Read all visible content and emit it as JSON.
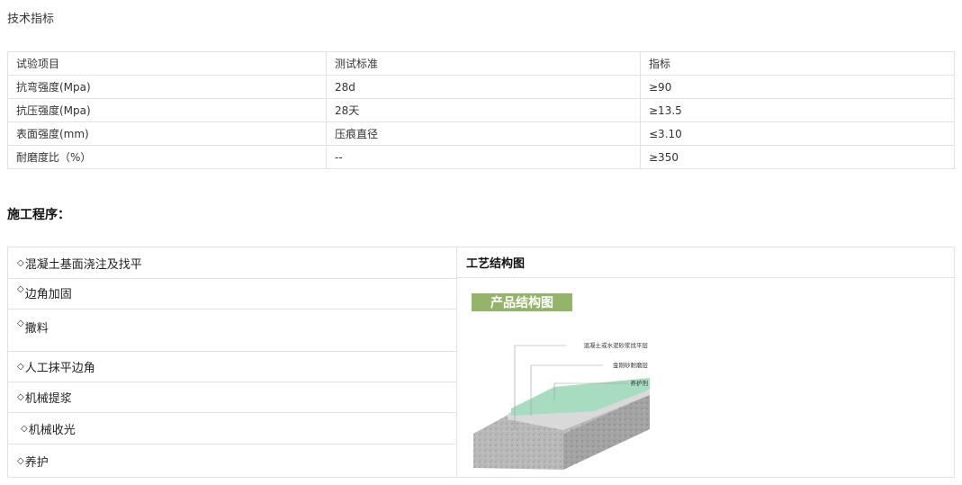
{
  "page_title": "技术指标",
  "spec_table": {
    "headers": [
      "试验项目",
      "测试标准",
      "指标"
    ],
    "rows": [
      [
        "抗弯强度(Mpa)",
        "28d",
        "≥90"
      ],
      [
        "抗压强度(Mpa)",
        "28天",
        "≥13.5"
      ],
      [
        "表面强度(mm)",
        "压痕直径",
        "≤3.10"
      ],
      [
        "耐磨度比（%）",
        "--",
        "≥350"
      ]
    ]
  },
  "procedure": {
    "title": "施工程序：",
    "bullet": "◇",
    "steps": [
      "混凝土基面浇注及找平",
      "边角加固",
      "撒料",
      "人工抹平边角",
      "机械提浆",
      "机械收光",
      "养护"
    ],
    "diagram_header": "工艺结构图",
    "diagram": {
      "banner": "产品结构图",
      "labels": [
        "混凝土或水泥砂浆找平层",
        "金刚砂耐磨层",
        "养护剂"
      ],
      "colors": {
        "banner": "#94b36b",
        "top_layer": "#a8dcc0",
        "mid_layer": "#d9d9d9",
        "base": "#b9b9b9"
      }
    }
  }
}
